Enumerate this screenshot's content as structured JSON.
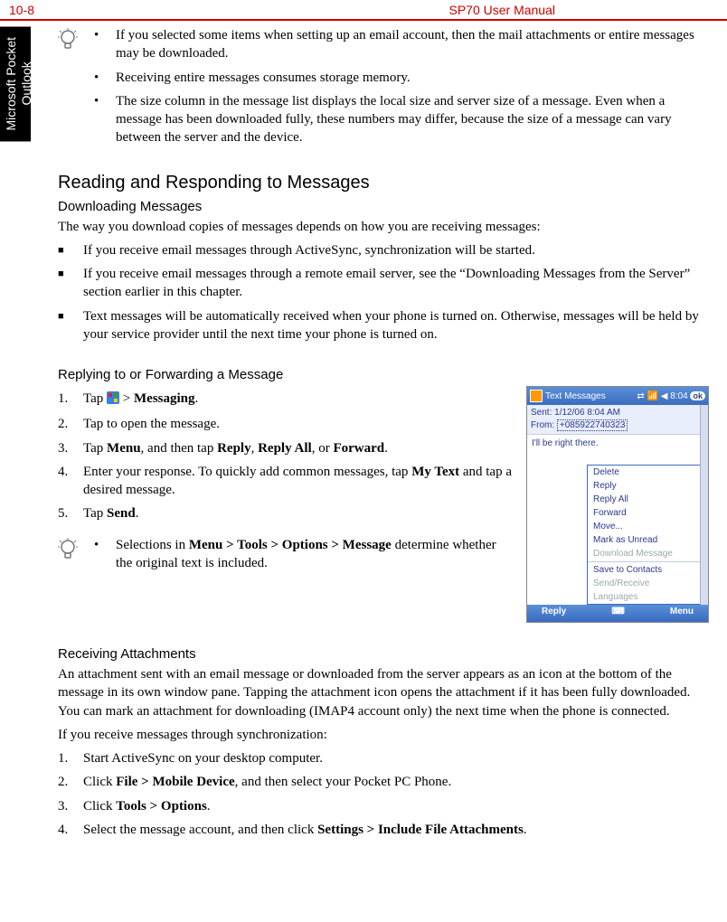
{
  "header": {
    "page_number": "10-8",
    "manual_title": "SP70 User Manual"
  },
  "side_tab": {
    "line1": "Microsoft Pocket",
    "line2": "Outlook"
  },
  "tip_box_1": {
    "items": [
      "If you selected some items when setting up an email account, then the mail attachments or entire messages may be downloaded.",
      "Receiving entire messages consumes storage memory.",
      "The size column in the message list displays the local size and server size of a message. Even when a message has been downloaded fully, these numbers may differ, because the size of a message can vary between the server and the device."
    ]
  },
  "section1": {
    "heading": "Reading and Responding to Messages",
    "sub1_heading": "Downloading Messages",
    "sub1_intro": "The way you download copies of messages depends on how you are receiving messages:",
    "sub1_items": [
      "If you receive email messages through ActiveSync, synchronization will be started.",
      "If you receive email messages through a remote email server, see the “Downloading Messages from the Server” section earlier in this chapter.",
      "Text messages will be automatically received when your phone is turned on. Otherwise, messages will be held by your service provider until the next time your phone is turned on."
    ]
  },
  "section2": {
    "heading": "Replying to or Forwarding a Message",
    "steps": {
      "s1_pre": "Tap ",
      "s1_post": " > ",
      "s1_bold": "Messaging",
      "s1_end": ".",
      "s2": "Tap to open the message.",
      "s3_pre": "Tap ",
      "s3_b1": "Menu",
      "s3_mid1": ", and then tap ",
      "s3_b2": "Reply",
      "s3_mid2": ", ",
      "s3_b3": "Reply All",
      "s3_mid3": ", or ",
      "s3_b4": "Forward",
      "s3_end": ".",
      "s4_pre": "Enter your response. To quickly add common messages, tap ",
      "s4_b1": "My Text",
      "s4_post": " and tap a desired message.",
      "s5_pre": "Tap ",
      "s5_b1": "Send",
      "s5_end": "."
    },
    "tip": {
      "pre": "Selections in ",
      "b": "Menu > Tools > Options > Message",
      "post": " determine whether the original text is included."
    }
  },
  "phone": {
    "title": "Text Messages",
    "time": "8:04",
    "ok": "ok",
    "sent_label": "Sent:",
    "sent_value": "1/12/06 8:04 AM",
    "from_label": "From:",
    "from_value": "+085922740323",
    "body": "I'll be right there.",
    "menu": [
      {
        "label": "Delete",
        "enabled": true
      },
      {
        "label": "Reply",
        "enabled": true
      },
      {
        "label": "Reply All",
        "enabled": true
      },
      {
        "label": "Forward",
        "enabled": true
      },
      {
        "label": "Move...",
        "enabled": true
      },
      {
        "label": "Mark as Unread",
        "enabled": true
      },
      {
        "label": "Download Message",
        "enabled": false
      },
      {
        "label": "Save to Contacts",
        "enabled": true
      },
      {
        "label": "Send/Receive",
        "enabled": false
      },
      {
        "label": "Languages",
        "enabled": false
      }
    ],
    "soft_left": "Reply",
    "soft_right": "Menu"
  },
  "section3": {
    "heading": "Receiving Attachments",
    "para1": "An attachment sent with an email message or downloaded from the server appears as an icon at the bottom of the message in its own window pane. Tapping the attachment icon opens the attachment if it has been fully downloaded. You can mark an attachment for downloading (IMAP4 account only) the next time when the phone is connected.",
    "para2": "If you receive messages through synchronization:",
    "steps": {
      "s1": "Start ActiveSync on your desktop computer.",
      "s2_pre": "Click ",
      "s2_b": "File > Mobile Device",
      "s2_post": ", and then select your Pocket PC Phone.",
      "s3_pre": "Click ",
      "s3_b": "Tools > Options",
      "s3_end": ".",
      "s4_pre": "Select the message account, and then click ",
      "s4_b": "Settings > Include File Attachments",
      "s4_end": "."
    }
  }
}
